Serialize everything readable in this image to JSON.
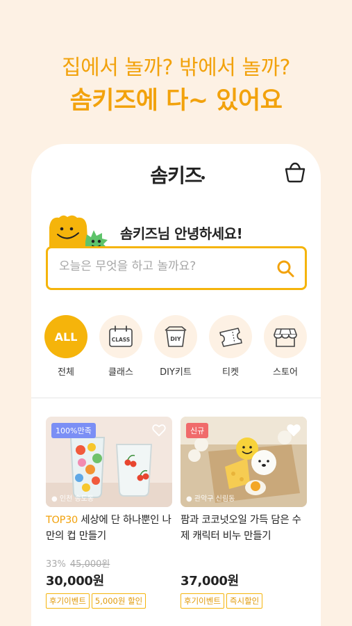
{
  "promo": {
    "line1": "집에서 놀까? 밖에서 놀까?",
    "line2": "솜키즈에 다~ 있어요"
  },
  "app": {
    "logo": "솜키즈",
    "greeting": "솜키즈님 안녕하세요!",
    "search_placeholder": "오늘은 무엇을 하고 놀까요?"
  },
  "categories": [
    {
      "label": "전체",
      "icon_text": "ALL",
      "icon": "all-icon",
      "active": true
    },
    {
      "label": "클래스",
      "icon_text": "CLASS",
      "icon": "class-calendar-icon",
      "active": false
    },
    {
      "label": "DIY키트",
      "icon_text": "DIY",
      "icon": "diy-box-icon",
      "active": false
    },
    {
      "label": "티켓",
      "icon_text": "",
      "icon": "ticket-icon",
      "active": false
    },
    {
      "label": "스토어",
      "icon_text": "",
      "icon": "store-icon",
      "active": false
    }
  ],
  "products": [
    {
      "badge": "100%만족",
      "badge_color": "#7b8ff5",
      "location": "인천 송도동",
      "title_highlight": "TOP30",
      "title": " 세상에 단 하나뿐인 나만의 컵 만들기",
      "discount": "33%",
      "original_price": "45,000원",
      "price": "30,000원",
      "tags": [
        "후기이벤트",
        "5,000원 할인"
      ]
    },
    {
      "badge": "신규",
      "badge_color": "#f06b6b",
      "location": "관악구 신림동",
      "title_highlight": "",
      "title": "팜과 코코넛오일 가득 담은 수제 캐릭터 비누 만들기",
      "discount": "",
      "original_price": "",
      "price": "37,000원",
      "tags": [
        "후기이벤트",
        "즉시할인"
      ]
    }
  ],
  "colors": {
    "accent": "#f5b40b",
    "background": "#fdf1e4"
  }
}
